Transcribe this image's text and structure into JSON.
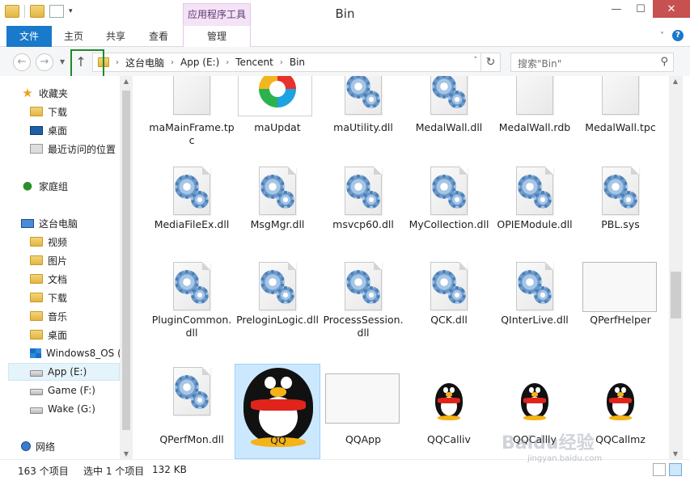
{
  "window": {
    "title": "Bin"
  },
  "ribbon": {
    "contextual_header": "应用程序工具",
    "tabs": [
      {
        "label": "文件",
        "icon": ""
      },
      {
        "label": "主页"
      },
      {
        "label": "共享"
      },
      {
        "label": "查看"
      },
      {
        "label": "管理"
      }
    ]
  },
  "address": {
    "crumbs": [
      "这台电脑",
      "App (E:)",
      "Tencent",
      "Bin"
    ]
  },
  "search": {
    "placeholder": "搜索\"Bin\""
  },
  "sidebar": {
    "items": [
      {
        "label": "收藏夹",
        "icon": "star-icon"
      },
      {
        "label": "下载",
        "icon": "download-folder-icon"
      },
      {
        "label": "桌面",
        "icon": "desktop-icon"
      },
      {
        "label": "最近访问的位置",
        "icon": "recent-places-icon"
      },
      {
        "label": "家庭组",
        "icon": "homegroup-icon"
      },
      {
        "label": "这台电脑",
        "icon": "computer-icon"
      },
      {
        "label": "视频",
        "icon": "folder-icon"
      },
      {
        "label": "图片",
        "icon": "folder-icon"
      },
      {
        "label": "文档",
        "icon": "folder-icon"
      },
      {
        "label": "下载",
        "icon": "download-folder-icon"
      },
      {
        "label": "音乐",
        "icon": "folder-icon"
      },
      {
        "label": "桌面",
        "icon": "folder-icon"
      },
      {
        "label": "Windows8_OS (",
        "icon": "windows-drive-icon"
      },
      {
        "label": "App (E:)",
        "icon": "drive-icon"
      },
      {
        "label": "Game (F:)",
        "icon": "drive-icon"
      },
      {
        "label": "Wake (G:)",
        "icon": "drive-icon"
      },
      {
        "label": "网络",
        "icon": "network-icon"
      }
    ]
  },
  "files": [
    {
      "name": "maMainFrame.tpc",
      "icon": "blank-file-icon"
    },
    {
      "name": "maUpdat",
      "icon": "updater-app-icon"
    },
    {
      "name": "maUtility.dll",
      "icon": "dll-gear-icon"
    },
    {
      "name": "MedalWall.dll",
      "icon": "dll-gear-icon"
    },
    {
      "name": "MedalWall.rdb",
      "icon": "blank-file-icon"
    },
    {
      "name": "MedalWall.tpc",
      "icon": "blank-file-icon"
    },
    {
      "name": "MediaFileEx.dll",
      "icon": "dll-gear-icon"
    },
    {
      "name": "MsgMgr.dll",
      "icon": "dll-gear-icon"
    },
    {
      "name": "msvcp60.dll",
      "icon": "dll-gear-icon"
    },
    {
      "name": "MyCollection.dll",
      "icon": "dll-gear-icon"
    },
    {
      "name": "OPIEModule.dll",
      "icon": "dll-gear-icon"
    },
    {
      "name": "PBL.sys",
      "icon": "dll-gear-icon"
    },
    {
      "name": "PluginCommon.dll",
      "icon": "dll-gear-icon"
    },
    {
      "name": "PreloginLogic.dll",
      "icon": "dll-gear-icon"
    },
    {
      "name": "ProcessSession.dll",
      "icon": "dll-gear-icon"
    },
    {
      "name": "QCK.dll",
      "icon": "dll-gear-icon"
    },
    {
      "name": "QInterLive.dll",
      "icon": "dll-gear-icon"
    },
    {
      "name": "QPerfHelper",
      "icon": "window-app-icon"
    },
    {
      "name": "QPerfMon.dll",
      "icon": "dll-gear-icon"
    },
    {
      "name": "QQ",
      "icon": "qq-penguin-icon"
    },
    {
      "name": "QQApp",
      "icon": "window-app-icon"
    },
    {
      "name": "QQCalliv",
      "icon": "qq-penguin-icon"
    },
    {
      "name": "QQCallly",
      "icon": "qq-penguin-icon"
    },
    {
      "name": "QQCallmz",
      "icon": "qq-penguin-icon"
    }
  ],
  "status": {
    "item_count": "163 个项目",
    "selection": "选中 1 个项目",
    "size": "132 KB"
  },
  "watermark": {
    "main": "Baidu经验",
    "sub": "jingyan.baidu.com"
  }
}
